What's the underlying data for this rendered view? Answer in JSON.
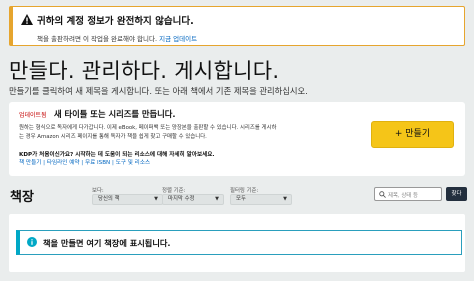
{
  "alert": {
    "title": "귀하의 계정 정보가 완전하지 않습니다.",
    "text": "책을 출판하려면 이 작업을 완료해야 합니다.",
    "link": "지금 업데이트"
  },
  "header": {
    "title": "만들다. 관리하다. 게시합니다.",
    "subtitle": "만들기를 클릭하여 새 제목을 게시합니다. 또는 아래 책에서 기존 제목을 관리하십시오."
  },
  "card": {
    "badge": "업데이트됨",
    "title": "새 타이틀 또는 시리즈를 만듭니다.",
    "desc_line1": "원하는 형식으로 독자에게 다가갑니다. 이제 eBook, 페이퍼백 또는 양장본을 출판할 수 있습니다. 시리즈를 게시하",
    "desc_line2": "는 경우 Amazon 시리즈 페이지를 통해 독자가 책을 쉽게 찾고 구매할 수 있습니다.",
    "question": "KDP가 처음이신가요? 시작하는 데 도움이 되는 리소스에 대해 자세히 알아보세요.",
    "links": [
      "책 만들기",
      "타임라인 예약",
      "무료 ISBN",
      "도구 및 리소스"
    ],
    "create_label": "+ 만들기"
  },
  "bookshelf": {
    "title": "책장",
    "filters": [
      {
        "label": "보다:",
        "value": "당신의 책",
        "name": "view"
      },
      {
        "label": "정렬 기준:",
        "value": "마지막 수정",
        "name": "sort"
      },
      {
        "label": "필터링 기준:",
        "value": "모두",
        "name": "filter"
      }
    ],
    "search_placeholder": "제목, 상태 등",
    "search_button": "찾다"
  },
  "info": {
    "text": "책을 만들면 여기 책장에 표시됩니다."
  },
  "colors": {
    "accent": "#f5c518",
    "alert_border": "#e6a52e",
    "info_border": "#00a8c6",
    "link": "#0066c0"
  }
}
